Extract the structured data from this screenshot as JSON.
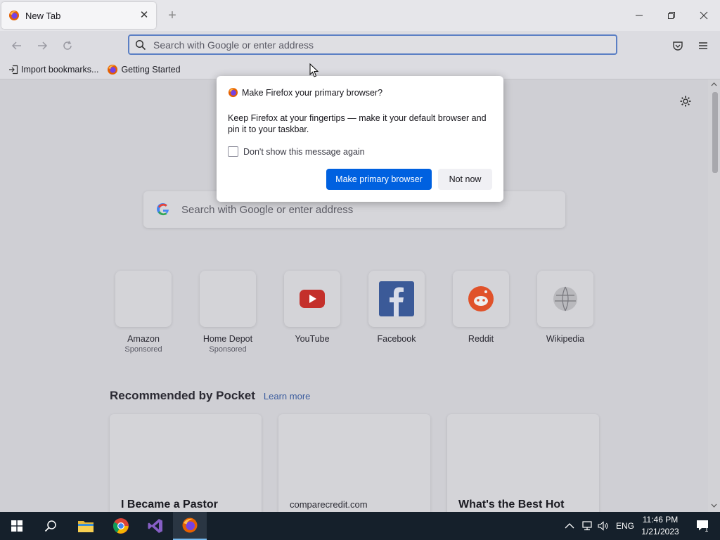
{
  "tab": {
    "title": "New Tab",
    "close": "✕",
    "new": "+"
  },
  "window": {
    "minimize": "minimize",
    "restore": "restore",
    "close": "close"
  },
  "urlbar": {
    "placeholder": "Search with Google or enter address"
  },
  "bookmarks": {
    "import": "Import bookmarks...",
    "getting_started": "Getting Started"
  },
  "newtab": {
    "search_placeholder": "Search with Google or enter address",
    "tiles": [
      {
        "name": "Amazon",
        "sponsored": "Sponsored"
      },
      {
        "name": "Home Depot",
        "sponsored": "Sponsored"
      },
      {
        "name": "YouTube"
      },
      {
        "name": "Facebook"
      },
      {
        "name": "Reddit"
      },
      {
        "name": "Wikipedia"
      }
    ],
    "pocket": {
      "title": "Recommended by Pocket",
      "learn_more": "Learn more",
      "cards": [
        {
          "text": "I Became a Pastor"
        },
        {
          "source": "comparecredit.com"
        },
        {
          "text": "What's the Best Hot"
        }
      ]
    }
  },
  "dialog": {
    "title": "Make Firefox your primary browser?",
    "body": "Keep Firefox at your fingertips — make it your default browser and pin it to your taskbar.",
    "checkbox_label": "Don't show this message again",
    "primary_button": "Make primary browser",
    "secondary_button": "Not now"
  },
  "taskbar": {
    "language": "ENG",
    "time": "11:46 PM",
    "date": "1/21/2023",
    "notification_count": "1"
  },
  "colors": {
    "accent": "#0061e0",
    "taskbar": "#15202b"
  }
}
